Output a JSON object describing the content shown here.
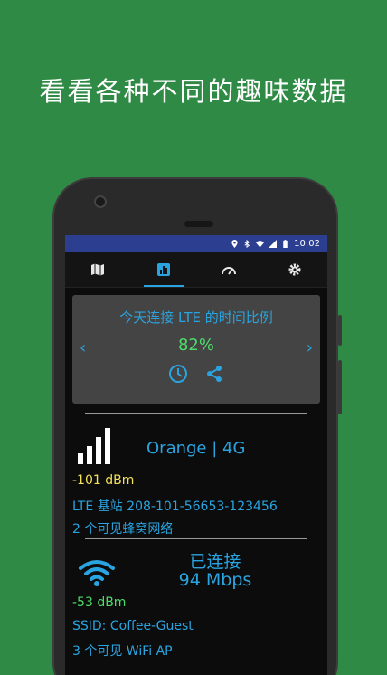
{
  "headline": "看看各种不同的趣味数据",
  "status_bar": {
    "time": "10:02",
    "icons": [
      "location-icon",
      "bluetooth-icon",
      "wifi-icon",
      "signal-icon",
      "battery-icon"
    ],
    "color": "#2c3e90"
  },
  "tabs": [
    {
      "icon": "map-icon",
      "active": false
    },
    {
      "icon": "stats-icon",
      "active": true
    },
    {
      "icon": "speedometer-icon",
      "active": false
    },
    {
      "icon": "gear-icon",
      "active": false
    }
  ],
  "card": {
    "title": "今天连接 LTE 的时间比例",
    "value": "82%",
    "prev": "‹",
    "next": "›"
  },
  "cellular": {
    "operator": "Orange | 4G",
    "signal": "-101 dBm",
    "cell_id": "LTE 基站 208-101-56653-123456",
    "networks": "2 个可见蜂窝网络"
  },
  "wifi": {
    "status": "已连接",
    "speed": "94 Mbps",
    "signal": "-53 dBm",
    "ssid": "SSID: Coffee-Guest",
    "networks": "3 个可见 WiFi AP"
  },
  "colors": {
    "background": "#2f8a45",
    "accent_blue": "#2aa4e0",
    "green": "#4ddc6a",
    "yellow": "#f4e15a"
  }
}
